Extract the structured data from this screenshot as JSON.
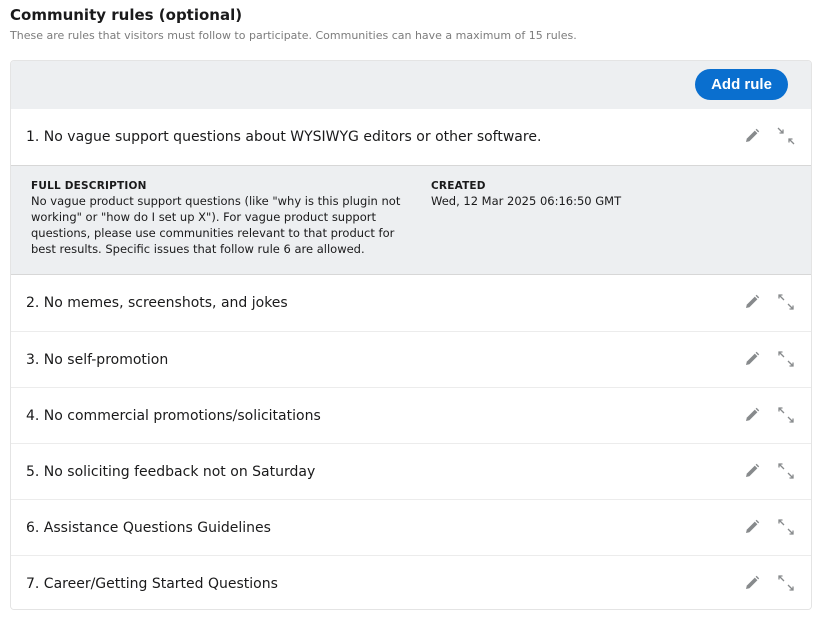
{
  "section": {
    "title": "Community rules (optional)",
    "subtitle": "These are rules that visitors must follow to participate. Communities can have a maximum of 15 rules."
  },
  "toolbar": {
    "add_rule_label": "Add rule",
    "accent_color": "#0a6fcf"
  },
  "rules": [
    {
      "text": "1. No vague support questions about WYSIWYG editors or other software.",
      "expanded": true,
      "details": {
        "description_label": "FULL DESCRIPTION",
        "description": "No vague product support questions (like \"why is this plugin not working\" or \"how do I set up X\"). For vague product support questions, please use communities relevant to that product for best results. Specific issues that follow rule 6 are allowed.",
        "created_label": "CREATED",
        "created": "Wed, 12 Mar 2025 06:16:50 GMT"
      }
    },
    {
      "text": "2. No memes, screenshots, and jokes",
      "expanded": false
    },
    {
      "text": "3. No self-promotion",
      "expanded": false
    },
    {
      "text": "4. No commercial promotions/solicitations",
      "expanded": false
    },
    {
      "text": "5. No soliciting feedback not on Saturday",
      "expanded": false
    },
    {
      "text": "6. Assistance Questions Guidelines",
      "expanded": false
    },
    {
      "text": "7. Career/Getting Started Questions",
      "expanded": false
    }
  ],
  "icons": {
    "edit": "pencil-icon",
    "expand": "expand-arrows-icon",
    "collapse": "collapse-arrows-icon"
  }
}
